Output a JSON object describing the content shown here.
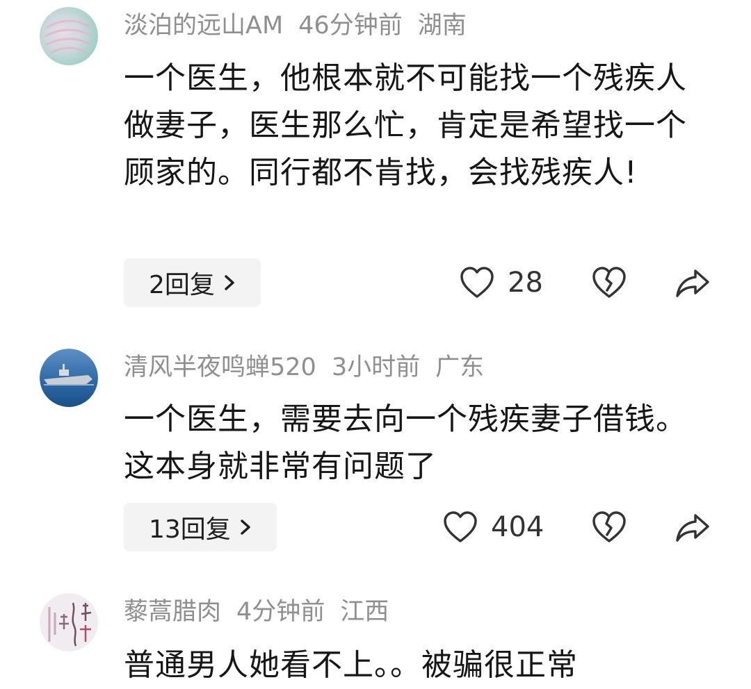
{
  "comments": [
    {
      "username": "淡泊的远山AM",
      "time": "46分钟前",
      "location": "湖南",
      "text": "一个医生，他根本就不可能找一个残疾人做妻子，医生那么忙，肯定是希望找一个顾家的。同行都不肯找，会找残疾人!",
      "reply_label": "2回复",
      "likes": "28"
    },
    {
      "username": "清风半夜鸣蝉520",
      "time": "3小时前",
      "location": "广东",
      "text": "一个医生，需要去向一个残疾妻子借钱。这本身就非常有问题了",
      "reply_label": "13回复",
      "likes": "404"
    },
    {
      "username": "藜蒿腊肉",
      "time": "4分钟前",
      "location": "江西",
      "text": "普通男人她看不上。。被骗很正常"
    }
  ],
  "icons": {
    "like": "heart-outline-icon",
    "dislike": "broken-heart-icon",
    "share": "share-arrow-icon",
    "chevron": "chevron-right-icon"
  },
  "colors": {
    "meta_text": "#8f8f8f",
    "body_text": "#161616",
    "reply_bg": "#f3f3f3",
    "icon_stroke": "#333333"
  }
}
